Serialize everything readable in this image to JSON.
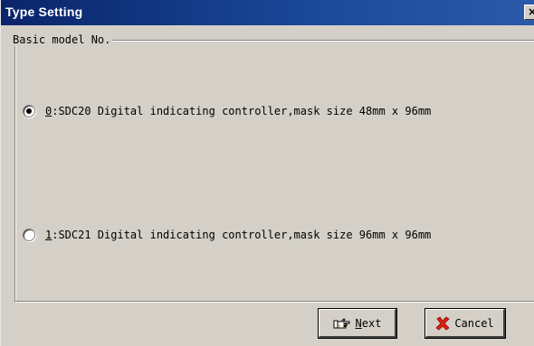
{
  "window": {
    "title": "Type Setting",
    "close_glyph": "×"
  },
  "group": {
    "label": "Basic model No."
  },
  "options": [
    {
      "key": "0",
      "text": ":SDC20 Digital indicating controller,mask size 48mm x 96mm",
      "selected": true
    },
    {
      "key": "1",
      "text": ":SDC21 Digital indicating controller,mask size 96mm x 96mm",
      "selected": false
    }
  ],
  "buttons": {
    "next": {
      "accel": "N",
      "rest": "ext",
      "icon": "pointing-hand-icon"
    },
    "cancel": {
      "label": "Cancel",
      "icon": "red-x-icon"
    }
  },
  "colors": {
    "title_bar": "#0a246a",
    "dialog_face": "#d4d0c8",
    "cancel_icon": "#e02010"
  }
}
